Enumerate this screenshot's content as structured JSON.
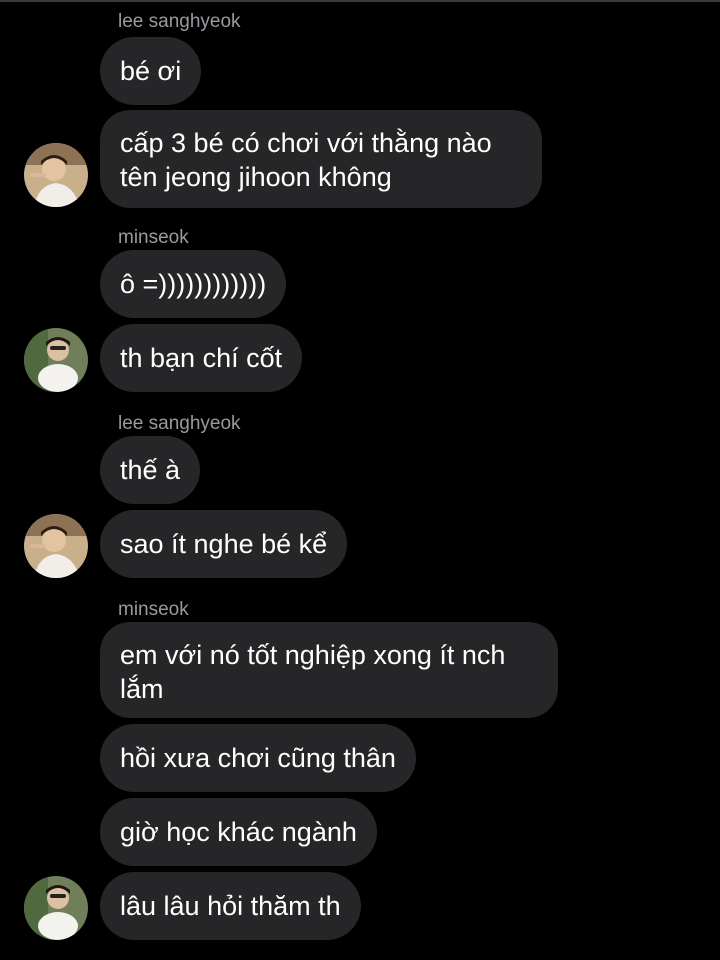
{
  "colors": {
    "background": "#000000",
    "bubble": "#262628",
    "text": "#ffffff",
    "sender": "#9a9a9f"
  },
  "messages": [
    {
      "sender": "lee sanghyeok"
    },
    {
      "text": "bé ơi"
    },
    {
      "text": "cấp 3 bé có chơi với thằng nào tên jeong jihoon không",
      "avatar": "profile-avatar-sanghyeok"
    },
    {
      "sender": "minseok"
    },
    {
      "text": "ô =))))))))))))"
    },
    {
      "text": "th bạn chí cốt",
      "avatar": "profile-avatar-minseok"
    },
    {
      "sender": "lee sanghyeok"
    },
    {
      "text": "thế à"
    },
    {
      "text": "sao ít nghe bé kể",
      "avatar": "profile-avatar-sanghyeok"
    },
    {
      "sender": "minseok"
    },
    {
      "text": "em với nó tốt nghiệp xong ít nch lắm"
    },
    {
      "text": "hồi xưa chơi cũng thân"
    },
    {
      "text": "giờ học khác ngành"
    },
    {
      "text": "lâu lâu hỏi thăm th",
      "avatar": "profile-avatar-minseok"
    }
  ]
}
